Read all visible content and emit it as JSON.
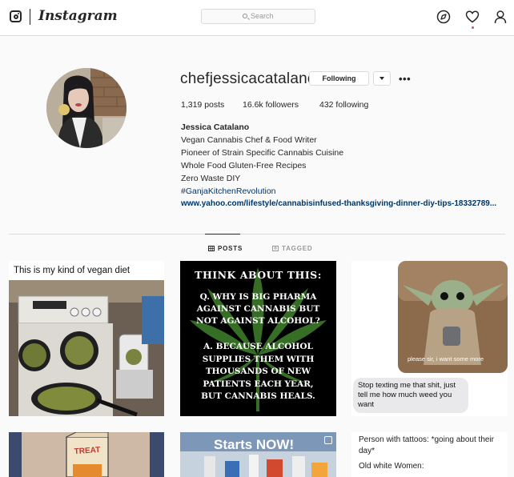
{
  "nav": {
    "brand": "Instagram",
    "search_placeholder": "Search"
  },
  "profile": {
    "username": "chefjessicacatalano",
    "follow_button_label": "Following",
    "stats": {
      "posts": "1,319 posts",
      "followers": "16.6k followers",
      "following": "432 following"
    },
    "bio": {
      "name": "Jessica Catalano",
      "lines": [
        "Vegan Cannabis Chef & Food Writer",
        "Pioneer of Strain Specific Cannabis Cuisine",
        "Whole Food Gluten-Free Recipes",
        "Zero Waste DIY"
      ],
      "hashtag": "#GanjaKitchenRevolution",
      "link": "www.yahoo.com/lifestyle/cannabisinfused-thanksgiving-dinner-diy-tips-18332789..."
    }
  },
  "tabs": [
    {
      "label": "POSTS",
      "active": true
    },
    {
      "label": "TAGGED",
      "active": false
    }
  ],
  "posts": {
    "p1": {
      "caption": "This is my kind of vegan diet"
    },
    "p2": {
      "heading": "THINK ABOUT THIS:",
      "question": [
        "Q. WHY IS BIG PHARMA",
        "AGAINST CANNABIS BUT",
        "NOT AGAINST ALCOHOL?"
      ],
      "answer": [
        "A. BECAUSE ALCOHOL",
        "SUPPLIES THEM WITH",
        "THOUSANDS OF NEW",
        "PATIENTS EACH YEAR,",
        "BUT CANNABIS HEALS."
      ]
    },
    "p3": {
      "image_caption": "please sir, i want some more",
      "bubble_lines": [
        "Stop texting me that shit, just",
        "tell me how much weed you",
        "want"
      ]
    },
    "p4": {
      "box_text": "TREAT"
    },
    "p5": {
      "banner": "Starts NOW!"
    },
    "p6": {
      "lines": [
        "Person with tattoos: *going about their",
        "day*"
      ],
      "line2": "Old white Women:"
    }
  },
  "colors": {
    "link": "#003569",
    "notification": "#ed4956",
    "leaf": "#3d7a2a",
    "bubble": "#e9e9eb"
  },
  "icons": [
    "instagram-glyph-icon",
    "search-icon",
    "compass-icon",
    "heart-icon",
    "user-icon",
    "grid-icon",
    "tag-icon"
  ]
}
